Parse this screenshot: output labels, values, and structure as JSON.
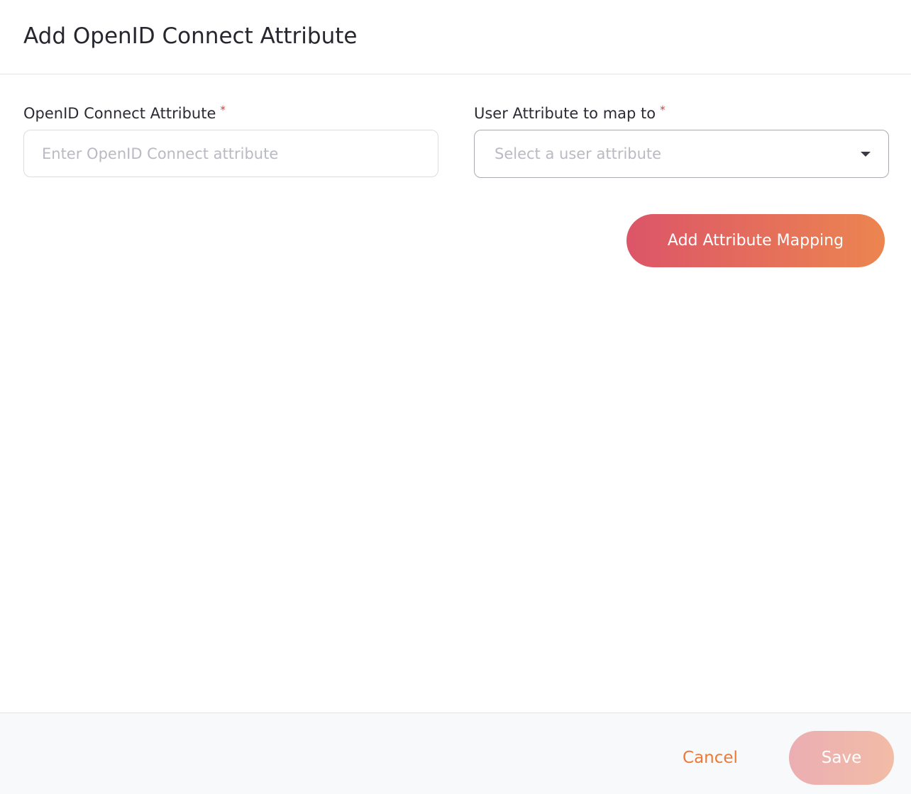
{
  "dialog": {
    "title": "Add OpenID Connect Attribute"
  },
  "form": {
    "oidc_attribute": {
      "label": "OpenID Connect Attribute",
      "required_mark": "*",
      "value": "",
      "placeholder": "Enter OpenID Connect attribute"
    },
    "user_attribute": {
      "label": "User Attribute to map to",
      "required_mark": "*",
      "selected": "",
      "placeholder": "Select a user attribute",
      "icon": "caret-down-icon"
    },
    "add_mapping_label": "Add Attribute Mapping"
  },
  "footer": {
    "cancel_label": "Cancel",
    "save_label": "Save"
  },
  "colors": {
    "accent_gradient_start": "#dc5568",
    "accent_gradient_end": "#ec8550",
    "cancel_text": "#eb7a37",
    "required_mark": "#e23a3a",
    "save_disabled_start": "#ebaeb3",
    "save_disabled_end": "#f2bca6"
  }
}
